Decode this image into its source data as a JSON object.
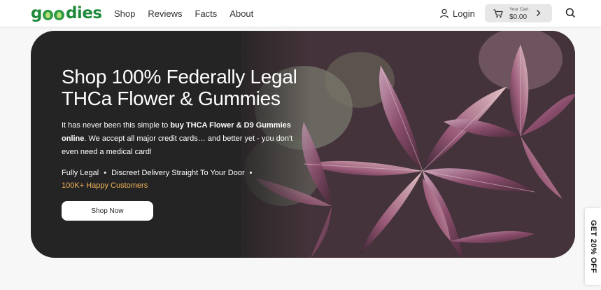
{
  "header": {
    "logo_text": "goodies",
    "nav": [
      "Shop",
      "Reviews",
      "Facts",
      "About"
    ],
    "login_label": "Login",
    "cart": {
      "label": "Your Cart",
      "amount": "$0.00"
    }
  },
  "hero": {
    "title": "Shop 100% Federally Legal THCa Flower & Gummies",
    "desc_pre": "It has never been this simple to ",
    "desc_bold": "buy THCA Flower & D9 Gummies online",
    "desc_post": ". We accept all major credit cards… and better yet - you don't even need a medical card!",
    "features": [
      "Fully Legal",
      "Discreet Delivery Straight To Your Door",
      "100K+ Happy Customers"
    ],
    "separator": "•",
    "cta_label": "Shop Now"
  },
  "side_tab": {
    "label": "GET 20% OFF"
  },
  "colors": {
    "brand_green": "#1e8a3a",
    "hero_bg": "#242424",
    "highlight": "#f3b559"
  },
  "icons": [
    "user-icon",
    "cart-icon",
    "chevron-right-icon",
    "search-icon"
  ]
}
